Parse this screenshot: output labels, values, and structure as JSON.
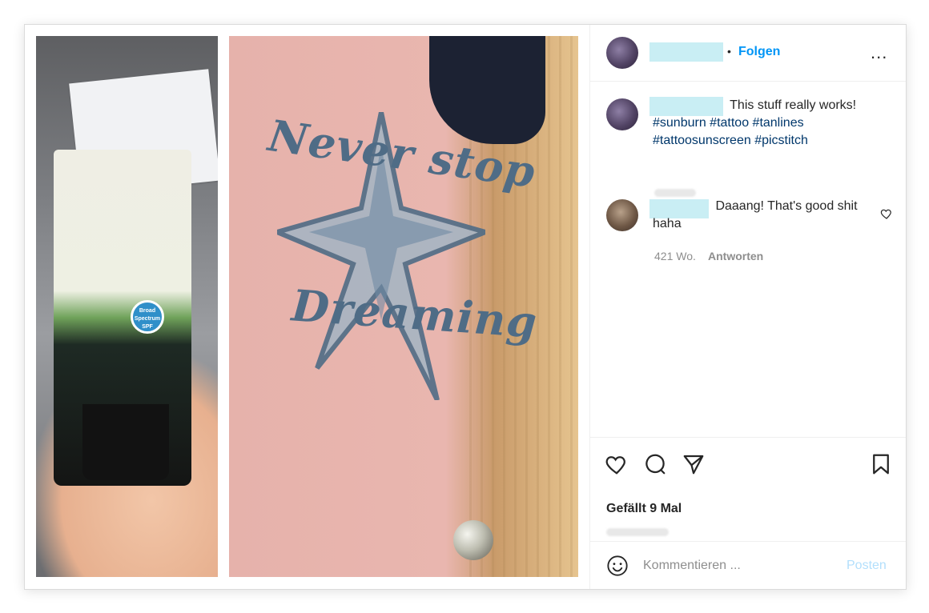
{
  "post": {
    "images": [
      "sunscreen-tube-photo",
      "tattoo-photo"
    ],
    "tattoo_lettering": [
      "Never stop",
      "Dreaming"
    ]
  },
  "header": {
    "follow_dot": "•",
    "follow_label": "Folgen",
    "more_label": "..."
  },
  "caption": {
    "text": "This stuff really works!",
    "hashtags": "#sunburn #tattoo #tanlines #tattoosunscreen #picstitch"
  },
  "comments": [
    {
      "text": "Daaang! That's good shit haha",
      "age": "421 Wo.",
      "reply_label": "Antworten"
    }
  ],
  "actions": {
    "likes_text": "Gefällt 9 Mal"
  },
  "comment_bar": {
    "placeholder": "Kommentieren ...",
    "post_label": "Posten"
  },
  "colors": {
    "accent": "#0095f6",
    "hashtag": "#00376b",
    "muted": "#8e8e8e",
    "post_disabled": "#b2dffc",
    "redaction": "#c9eef4"
  },
  "icons": [
    "heart-icon",
    "comment-icon",
    "share-icon",
    "bookmark-icon",
    "emoji-icon",
    "more-icon",
    "small-heart-icon"
  ]
}
